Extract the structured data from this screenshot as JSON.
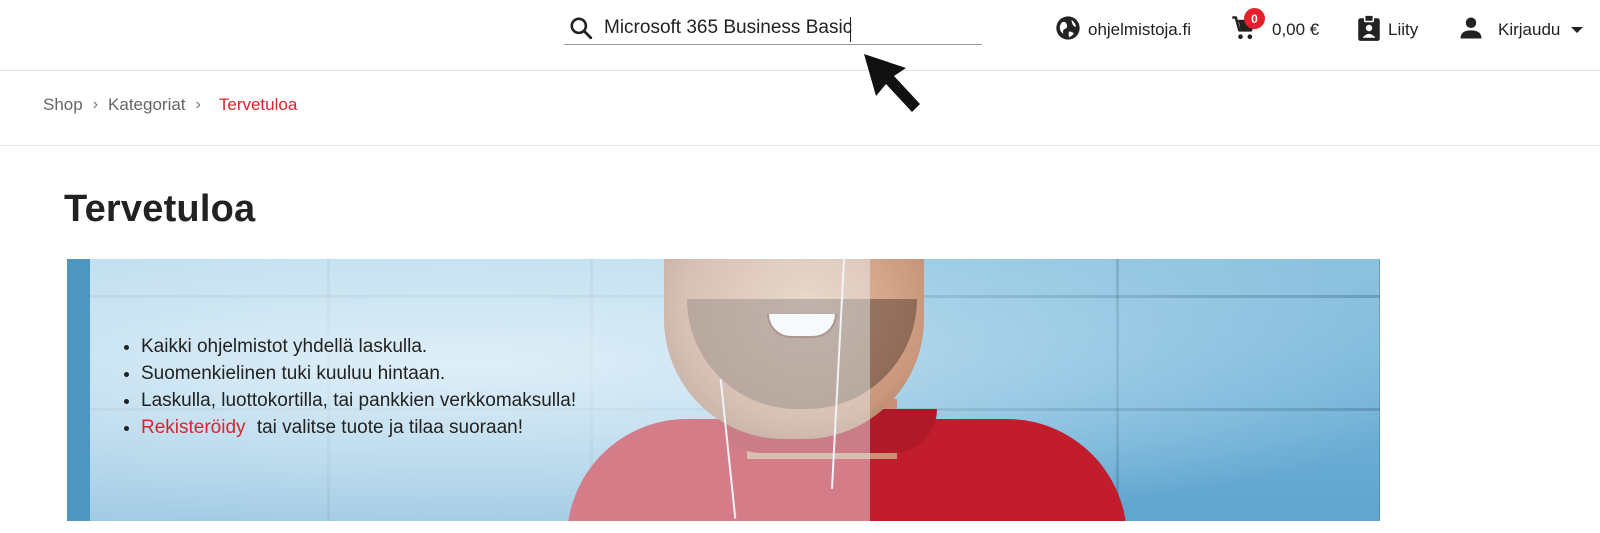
{
  "header": {
    "search": {
      "value": "Microsoft 365 Business Basic",
      "icon": "search-icon"
    },
    "site": {
      "label": "ohjelmistoja.fi",
      "icon": "globe-icon"
    },
    "cart": {
      "count": "0",
      "total": "0,00 €",
      "icon": "cart-icon"
    },
    "join": {
      "label": "Liity",
      "icon": "badge-icon"
    },
    "login": {
      "label": "Kirjaudu",
      "icon": "person-icon"
    }
  },
  "breadcrumb": {
    "items": [
      "Shop",
      "Kategoriat"
    ],
    "current": "Tervetuloa"
  },
  "page": {
    "title": "Tervetuloa"
  },
  "banner": {
    "bullets": [
      "Kaikki ohjelmistot yhdellä laskulla.",
      "Suomenkielinen tuki kuuluu hintaan.",
      "Laskulla, luottokortilla, tai pankkien verkkomaksulla!"
    ],
    "last_link": "Rekisteröidy",
    "last_text": "tai valitse tuote ja tilaa suoraan!"
  },
  "colors": {
    "accent": "#d9252e",
    "badge": "#e4202e",
    "text": "#222222"
  }
}
